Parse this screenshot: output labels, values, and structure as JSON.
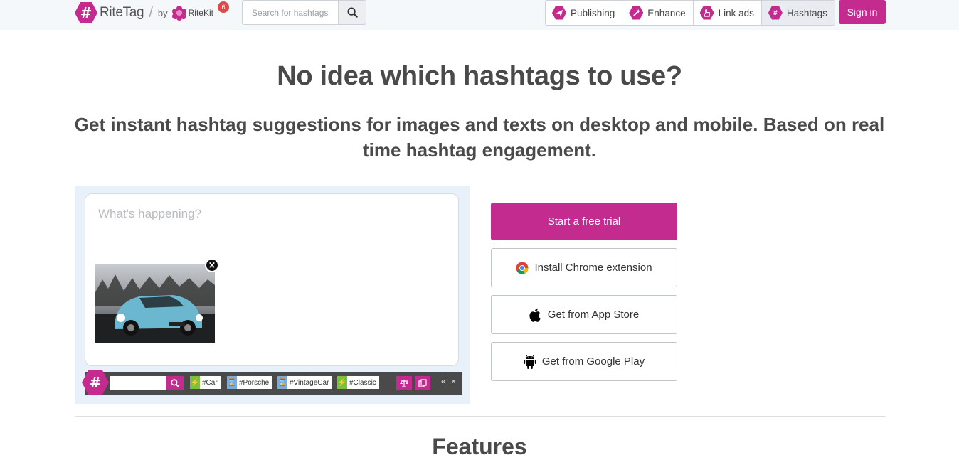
{
  "header": {
    "logo_name": "RiteTag",
    "logo_slash": "/",
    "logo_by": "by",
    "ritekit_name": "RiteKit",
    "notification_count": "6",
    "search_placeholder": "Search for hashtags",
    "nav": [
      {
        "label": "Publishing",
        "icon": "paper-plane-icon"
      },
      {
        "label": "Enhance",
        "icon": "magic-wand-icon"
      },
      {
        "label": "Link ads",
        "icon": "pointer-hand-icon"
      },
      {
        "label": "Hashtags",
        "icon": "hashtag-icon",
        "active": true
      }
    ],
    "signin_label": "Sign in"
  },
  "hero": {
    "title": "No idea which hashtags to use?",
    "subtitle": "Get instant hashtag suggestions for images and texts on desktop and mobile. Based on real time hashtag engagement."
  },
  "demo": {
    "compose_placeholder": "What's happening?",
    "tags": [
      {
        "label": "#Car",
        "kind": "green"
      },
      {
        "label": "#Porsche",
        "kind": "blue"
      },
      {
        "label": "#VintageCar",
        "kind": "blue"
      },
      {
        "label": "#Classic",
        "kind": "green"
      }
    ],
    "collapse_label": "«",
    "close_label": "×"
  },
  "cta": {
    "trial": "Start a free trial",
    "chrome": "Install Chrome extension",
    "appstore": "Get from App Store",
    "googleplay": "Get from Google Play"
  },
  "features_title": "Features",
  "colors": {
    "brand": "#c32b8f",
    "tag_green": "#7ac142",
    "tag_blue": "#7fa9d6"
  }
}
